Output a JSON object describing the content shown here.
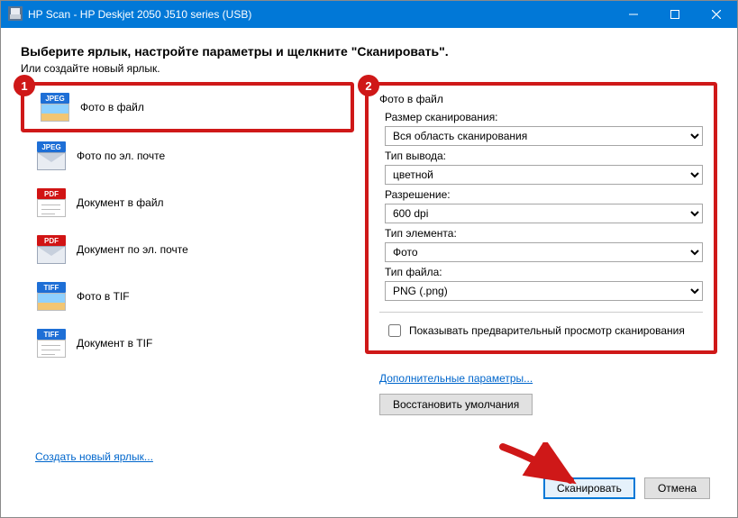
{
  "window": {
    "title": "HP Scan - HP Deskjet 2050 J510 series (USB)"
  },
  "heading": "Выберите ярлык, настройте параметры и щелкните \"Сканировать\".",
  "subheading": "Или создайте новый ярлык.",
  "markers": {
    "m1": "1",
    "m2": "2"
  },
  "shortcuts": [
    {
      "label": "Фото в файл",
      "tag": "JPEG",
      "glyph": "photo"
    },
    {
      "label": "Фото по эл. почте",
      "tag": "JPEG",
      "glyph": "env"
    },
    {
      "label": "Документ в файл",
      "tag": "PDF",
      "glyph": "doc"
    },
    {
      "label": "Документ по эл. почте",
      "tag": "PDF",
      "glyph": "env"
    },
    {
      "label": "Фото в TIF",
      "tag": "TIFF",
      "glyph": "photo"
    },
    {
      "label": "Документ в TIF",
      "tag": "TIFF",
      "glyph": "doc"
    }
  ],
  "settings": {
    "title": "Фото в файл",
    "scan_size_label": "Размер сканирования:",
    "scan_size_value": "Вся область сканирования",
    "output_type_label": "Тип вывода:",
    "output_type_value": "цветной",
    "resolution_label": "Разрешение:",
    "resolution_value": "600 dpi",
    "item_type_label": "Тип элемента:",
    "item_type_value": "Фото",
    "file_type_label": "Тип файла:",
    "file_type_value": "PNG (.png)",
    "preview_checkbox": "Показывать предварительный просмотр сканирования"
  },
  "links": {
    "advanced": "Дополнительные параметры...",
    "create_shortcut": "Создать новый ярлык..."
  },
  "buttons": {
    "restore": "Восстановить умолчания",
    "scan": "Сканировать",
    "cancel": "Отмена"
  }
}
